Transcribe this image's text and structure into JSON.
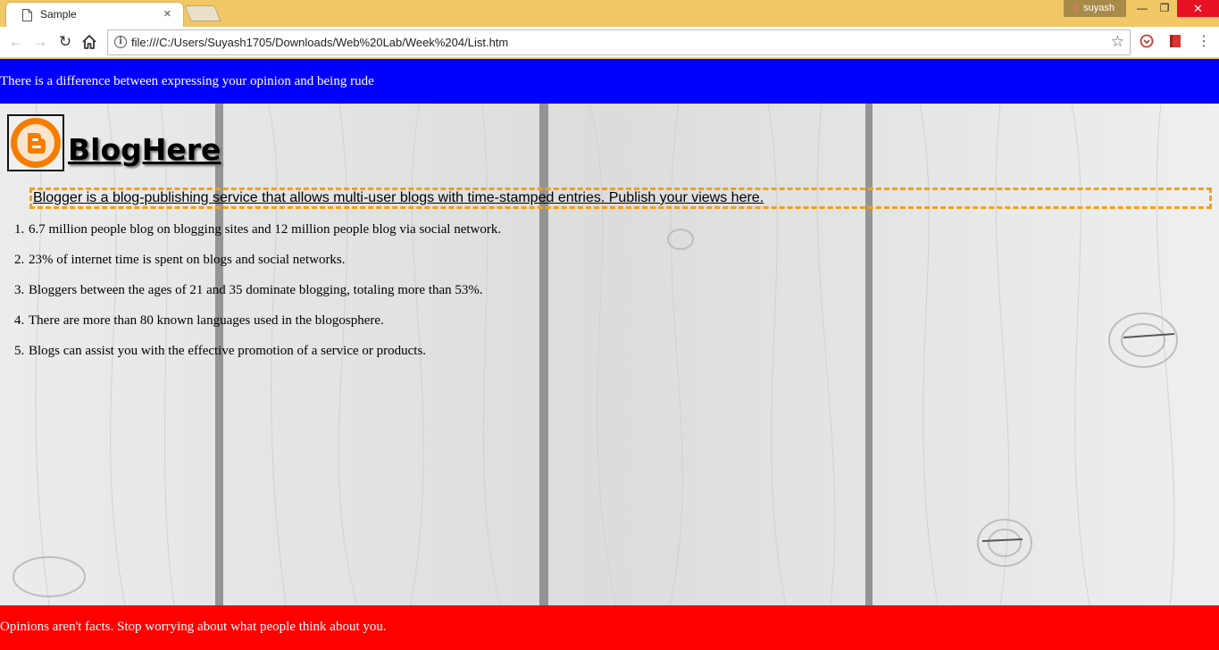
{
  "browser": {
    "tab_title": "Sample",
    "tab_close_glyph": "×",
    "profile_name": "suyash",
    "window_minimize_glyph": "—",
    "window_restore_glyph": "❐",
    "window_close_glyph": "✕",
    "url": "file:///C:/Users/Suyash1705/Downloads/Web%20Lab/Week%204/List.htm",
    "nav_back_glyph": "←",
    "nav_forward_glyph": "→",
    "reload_glyph": "↻",
    "bookmark_glyph": "☆",
    "menu_glyph": "⋮",
    "icons": [
      "page-icon",
      "info-icon",
      "star-icon",
      "pocket-icon",
      "bookmark-ext-icon",
      "menu-icon"
    ]
  },
  "page": {
    "top_banner_text": "There is a difference between expressing your opinion and being rude",
    "site_title": "BlogHere",
    "intro_text": "Blogger is a blog-publishing service that allows multi-user blogs with time-stamped entries. Publish your views here.",
    "facts": [
      {
        "num": "1.",
        "text": "6.7 million people blog on blogging sites and 12 million people blog via social network."
      },
      {
        "num": "2.",
        "text": "23% of internet time is spent on blogs and social networks."
      },
      {
        "num": "3.",
        "text": "Bloggers between the ages of 21 and 35 dominate blogging, totaling more than 53%."
      },
      {
        "num": "4.",
        "text": "There are more than 80 known languages used in the blogosphere."
      },
      {
        "num": "5.",
        "text": "Blogs can assist you with the effective promotion of a service or products."
      }
    ],
    "bottom_banner_text": "Opinions aren't facts. Stop worrying about what people think about you."
  },
  "colors": {
    "chrome_frame": "#f2c766",
    "top_banner": "#0000ff",
    "bottom_banner": "#ff0000",
    "intro_border": "#f0a020",
    "logo_orange": "#f57d00"
  }
}
